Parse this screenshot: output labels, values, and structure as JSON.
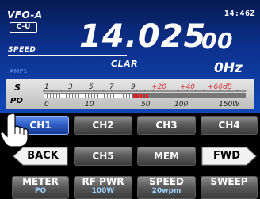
{
  "display": {
    "vfo": "VFO-A",
    "mode": "C-U",
    "clock": "14:46Z",
    "speed_label": "SPEED",
    "frequency_main": "14.025",
    "frequency_small": "00",
    "clar_label": "CLAR",
    "clar_offset": "0Hz",
    "amp_label": "AMP1"
  },
  "meter": {
    "s_label": "S",
    "po_label": "PO",
    "s_ticks": [
      "1",
      "3",
      "5",
      "7",
      "9"
    ],
    "s_ticks_over": [
      "+20",
      "+40",
      "+60dB"
    ],
    "po_ticks": [
      "0",
      "10",
      "50",
      "100",
      "150W"
    ],
    "level_fraction": 0.52,
    "colors": {
      "bar": "#ffffff",
      "over": "#d62020",
      "panel": "#d6d6d6"
    }
  },
  "keys": {
    "row1": [
      "CH1",
      "CH2",
      "CH3",
      "CH4"
    ],
    "row2": {
      "back": "BACK",
      "ch5": "CH5",
      "mem": "MEM",
      "fwd": "FWD"
    },
    "row3": [
      {
        "label": "METER",
        "value": "PO"
      },
      {
        "label": "RF PWR",
        "value": "100W"
      },
      {
        "label": "SPEED",
        "value": "20wpm"
      },
      {
        "label": "SWEEP",
        "value": ""
      }
    ],
    "selected": "CH1"
  },
  "icons": {
    "pointer": "hand-pointer-icon"
  }
}
